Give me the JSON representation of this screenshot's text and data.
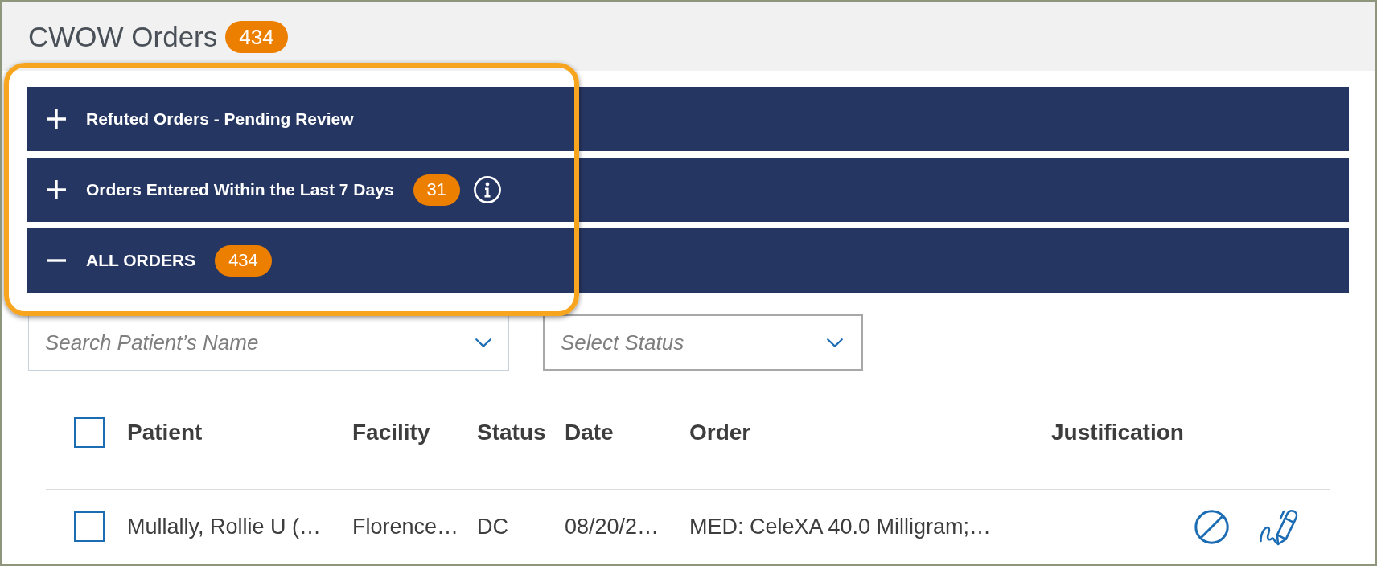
{
  "header": {
    "title": "CWOW Orders",
    "count": "434"
  },
  "accordion": {
    "highlighted": true,
    "sections": [
      {
        "label": "Refuted Orders - Pending Review",
        "expanded": false
      },
      {
        "label": "Orders Entered Within the Last 7 Days",
        "expanded": false,
        "count": "31",
        "info": true
      },
      {
        "label": "ALL ORDERS",
        "expanded": true,
        "count": "434"
      }
    ]
  },
  "filters": [
    {
      "kind": "search",
      "placeholder": "Search Patient’s Name"
    },
    {
      "kind": "select",
      "placeholder": "Select Status"
    }
  ],
  "table": {
    "select_all_checked": false,
    "columns": [
      "Patient",
      "Facility",
      "Status",
      "Date",
      "Order",
      "Justification"
    ],
    "rows": [
      {
        "checked": false,
        "cells": [
          "Mullally, Rollie U (…",
          "Florence…",
          "DC",
          "08/20/2…",
          "MED: CeleXA 40.0 Milligram;…"
        ]
      }
    ]
  }
}
